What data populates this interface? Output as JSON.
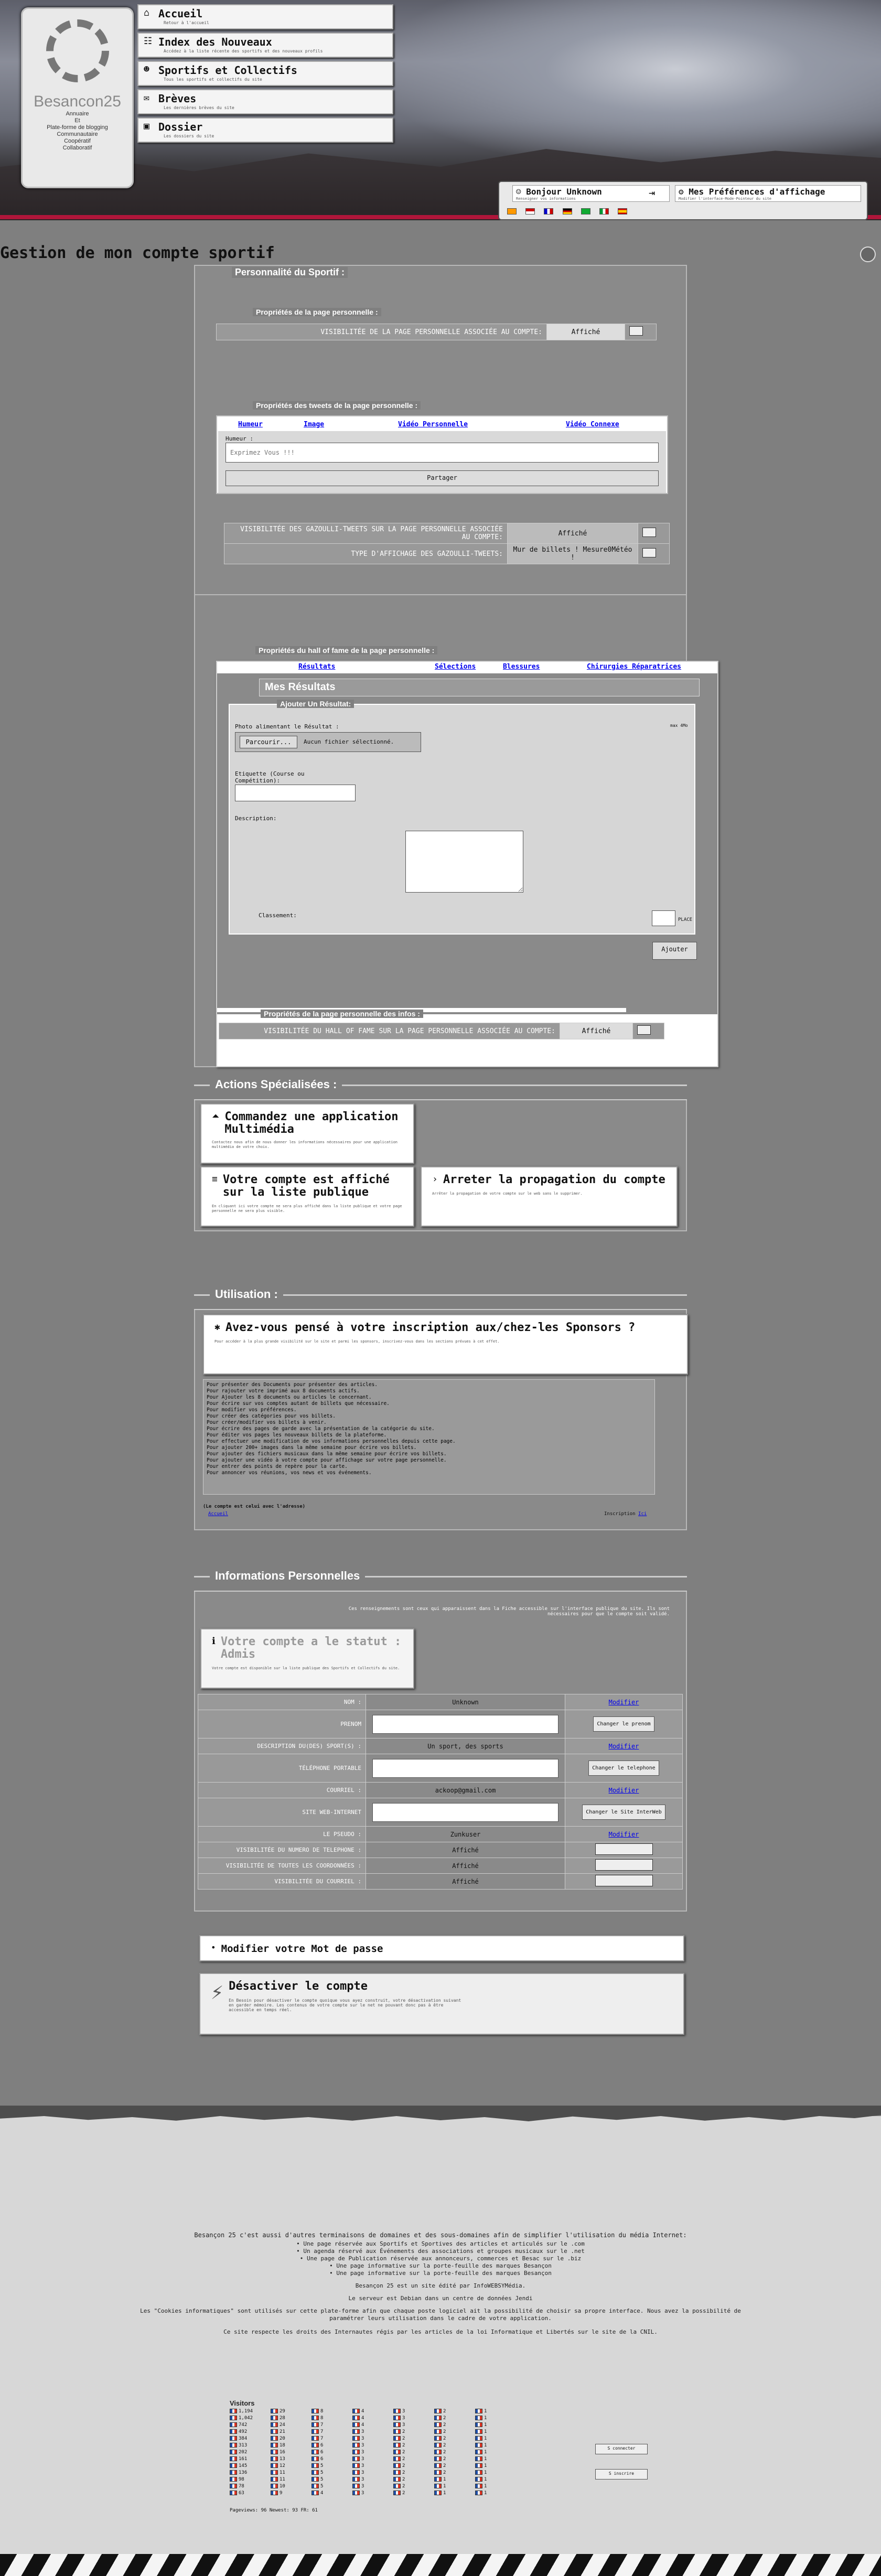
{
  "nav": [
    {
      "icon": "home-icon",
      "label": "Accueil",
      "desc": "Retour à l'accueil"
    },
    {
      "icon": "sitemap-icon",
      "label": "Index des Nouveaux",
      "desc": "Accédez à la liste récente des sportifs et des nouveaux profils"
    },
    {
      "icon": "users-icon",
      "label": "Sportifs et Collectifs",
      "desc": "Tous les sportifs et collectifs du site"
    },
    {
      "icon": "chat-icon",
      "label": "Brèves",
      "desc": "Les dernières brèves du site"
    },
    {
      "icon": "folder-icon",
      "label": "Dossier",
      "desc": "Les dossiers du site"
    }
  ],
  "logo": {
    "name": "Besancon25",
    "lines": [
      "Annuaire",
      "Et",
      "Plate-forme de blogging",
      "Communautaire",
      "Coopératif",
      "Collaboratif"
    ]
  },
  "userbar": {
    "greeting": "Bonjour Unknown",
    "greeting_sub": "Renseigner vos informations",
    "prefs": "Mes Préférences d'affichage",
    "prefs_sub": "Modifier l'interface-Mode-Pointeur du site"
  },
  "page_title": "Gestion de mon compte sportif",
  "perso": {
    "legend": "Personnalité du Sportif :",
    "props_legend": "Propriétés de la page personnelle :",
    "visibility_label": "VISIBILITÉE DE LA PAGE PERSONNELLE ASSOCIÉE AU COMPTE:",
    "visibility_value": "Affiché",
    "tweets_legend": "Propriétés des tweets de la page personnelle :",
    "tweet_tabs": [
      "Humeur",
      "Image",
      "Vidéo Personnelle",
      "Vidéo Connexe"
    ],
    "humeur_label": "Humeur :",
    "tweet_placeholder": "Exprimez Vous !!!",
    "share_button": "Partager",
    "gazou_visibility_label": "VISIBILITÉE DES GAZOULLI-TWEETS SUR LA PAGE PERSONNELLE ASSOCIÉE AU COMPTE:",
    "gazou_visibility_value": "Affiché",
    "gazou_type_label": "TYPE D'AFFICHAGE DES GAZOULLI-TWEETS:",
    "gazou_type_value": "Mur de billets ! Mesure0Météo !"
  },
  "hof": {
    "legend": "Propriétés du hall of fame de la page personnelle :",
    "tabs": [
      "Résultats",
      "Sélections",
      "Blessures",
      "Chirurgies Réparatrices"
    ],
    "title": "Mes Résultats",
    "add_legend": "Ajouter Un Résultat:",
    "photo_label": "Photo alimentant le Résultat :",
    "photo_hint": "max 4Mo",
    "browse_button": "Parcourir...",
    "no_file": "Aucun fichier sélectionné.",
    "etiquette_label": "Etiquette (Course ou Compétition):",
    "description_label": "Description:",
    "classement_label": "Classement:",
    "place_label": "PLACE",
    "add_button": "Ajouter",
    "infos_legend": "Propriétés de la page personnelle des infos :",
    "hof_visibility_label": "VISIBILITÉE DU HALL OF FAME SUR LA PAGE PERSONNELLE ASSOCIÉE AU COMPTE:",
    "hof_visibility_value": "Affiché"
  },
  "actions": {
    "title": "Actions Spécialisées :",
    "cards": [
      {
        "title": "Commandez une application Multimédia",
        "desc": "Contactez nous afin de nous donner les informations nécessaires pour une application multimédia de votre choix."
      },
      {
        "title": "Votre compte est affiché sur la liste publique",
        "desc": "En cliquant ici votre compte ne sera plus affiché dans la liste publique et votre page personnelle ne sera plus visible."
      },
      {
        "title": "Arreter la propagation du compte",
        "desc": "Arrêter la propagation de votre compte sur le web sans le supprimer."
      }
    ]
  },
  "utilisation": {
    "title": "Utilisation :",
    "card_title": "Avez-vous pensé à votre inscription aux/chez-les Sponsors ?",
    "card_desc": "Pour accéder à la plus grande visibilité sur le site et parmi les sponsors, inscrivez-vous dans les sections prévues à cet effet.",
    "items": [
      "Pour présenter des Documents pour présenter des articles.",
      "Pour rajouter votre imprimé aux 8 documents actifs.",
      "Pour Ajouter les 8 documents ou articles le concernant.",
      "Pour écrire sur vos comptes autant de billets que nécessaire.",
      "Pour modifier vos préférences.",
      "Pour créer des catégories pour vos billets.",
      "Pour créer/modifier vos billets à venir.",
      "Pour écrire des pages de garde avec la présentation de la catégorie du site.",
      "Pour éditer vos pages les nouveaux billets de la plateforme.",
      "Pour effectuer une modification de vos informations personnelles depuis cette page.",
      "Pour ajouter 200+ images dans la même semaine pour écrire vos billets.",
      "Pour ajouter des fichiers musicaux dans la même semaine pour écrire vos billets.",
      "Pour ajouter une vidéo à votre compte pour affichage sur votre page personnelle.",
      "Pour entrer des points de repère pour la carte.",
      "Pour annoncer vos réunions, vos news et vos événements."
    ],
    "note": "(Le compte est celui avec l'adresse)",
    "left_link": "Accueil",
    "right_text": "Inscription",
    "right_link": "Ici"
  },
  "infos": {
    "title": "Informations Personnelles",
    "notice": "Ces renseignements sont ceux qui apparaissent dans la Fiche accessible sur l'interface publique du site. Ils sont nécessaires pour que le compte soit validé.",
    "status_title": "Votre compte a le statut : Admis",
    "status_desc": "Votre compte est disponible sur la liste publique des Sportifs et Collectifs du site.",
    "rows": [
      {
        "label": "NOM :",
        "value": "Unknown",
        "action": "Modifier",
        "kind": "text"
      },
      {
        "label": "PRENOM",
        "value": "",
        "action": "Changer le prenom",
        "kind": "input"
      },
      {
        "label": "DESCRIPTION DU(DES) SPORT(S) :",
        "value": "Un sport, des sports",
        "action": "Modifier",
        "kind": "text"
      },
      {
        "label": "TÉLÉPHONE PORTABLE",
        "value": "",
        "action": "Changer le telephone",
        "kind": "input"
      },
      {
        "label": "COURRIEL :",
        "value": "ackoop@gmail.com",
        "action": "Modifier",
        "kind": "text"
      },
      {
        "label": "SITE WEB-INTERNET",
        "value": "",
        "action": "Changer le Site InterWeb",
        "kind": "input"
      },
      {
        "label": "LE PSEUDO :",
        "value": "Zunkuser",
        "action": "Modifier",
        "kind": "text"
      },
      {
        "label": "VISIBILITÉE DU NUMERO DE TELEPHONE :",
        "value": "Affiché",
        "action": "",
        "kind": "toggle"
      },
      {
        "label": "VISIBILITÉE DE TOUTES LES COORDONNÉES :",
        "value": "Affiché",
        "action": "",
        "kind": "toggle"
      },
      {
        "label": "VISIBILITÉE DU COURRIEL :",
        "value": "Affiché",
        "action": "",
        "kind": "toggle"
      }
    ]
  },
  "password": {
    "title": "Modifier votre Mot de passe"
  },
  "deactivate": {
    "title": "Désactiver le compte",
    "desc": "En Besoin pour désactiver le compte quoique vous ayez construit, votre désactivation suivant en garder mémoire. Les contenus de votre compte sur le net ne pouvant donc pas à être accessible en temps réel."
  },
  "footer": {
    "intro": "Besançon 25 c'est aussi d'autres terminaisons de domaines et des sous-domaines afin de simplifier l'utilisation du média Internet:",
    "lines": [
      "• Une page réservée aux Sportifs et Sportives des articles et articulés sur le .com",
      "• Un agenda réservé aux Événements des associations et groupes musicaux sur le .net",
      "• Une page de Publication réservée aux annonceurs, commerces et Besac sur le .biz",
      "• Une page informative sur la porte-feuille des marques Besançon",
      "• Une page informative sur la porte-feuille des marques Besançon"
    ],
    "edited": "Besançon 25 est un site édité par InfoWEBSYMédia.",
    "host": "Le serveur est Debian dans un centre de données Jendi",
    "cookies": "Les \"Cookies informatiques\" sont utilisés sur cette plate-forme afin que chaque poste logiciel ait la possibilité de choisir sa propre interface. Nous avez la possibilité de paramétrer leurs utilisation dans le cadre de votre application.",
    "respect": "Ce site respecte les droits des Internautes régis par les articles de la loi Informatique et Libertés sur le site de la CNIL.",
    "visitors_title": "Visitors",
    "visitor_cols": [
      [
        "1,194",
        "1,042",
        "742",
        "492",
        "384",
        "313",
        "202",
        "161",
        "145",
        "136",
        "98",
        "78",
        "63"
      ],
      [
        "29",
        "28",
        "24",
        "21",
        "20",
        "18",
        "16",
        "13",
        "12",
        "11",
        "11",
        "10",
        "9"
      ],
      [
        "8",
        "8",
        "7",
        "7",
        "7",
        "6",
        "6",
        "6",
        "5",
        "5",
        "5",
        "5",
        "4"
      ],
      [
        "4",
        "4",
        "4",
        "3",
        "3",
        "3",
        "3",
        "3",
        "3",
        "3",
        "3",
        "3",
        "3"
      ],
      [
        "3",
        "3",
        "3",
        "2",
        "2",
        "2",
        "2",
        "2",
        "2",
        "2",
        "2",
        "2",
        "2"
      ],
      [
        "2",
        "2",
        "2",
        "2",
        "2",
        "2",
        "2",
        "2",
        "2",
        "2",
        "1",
        "1",
        "1"
      ],
      [
        "1",
        "1",
        "1",
        "1",
        "1",
        "1",
        "1",
        "1",
        "1",
        "1",
        "1",
        "1",
        "1"
      ]
    ],
    "visitors_bottom": "Pageviews: 96  Newest: 93  FR: 61",
    "login_btn1": "S connecter",
    "login_btn2": "S inscrire"
  }
}
